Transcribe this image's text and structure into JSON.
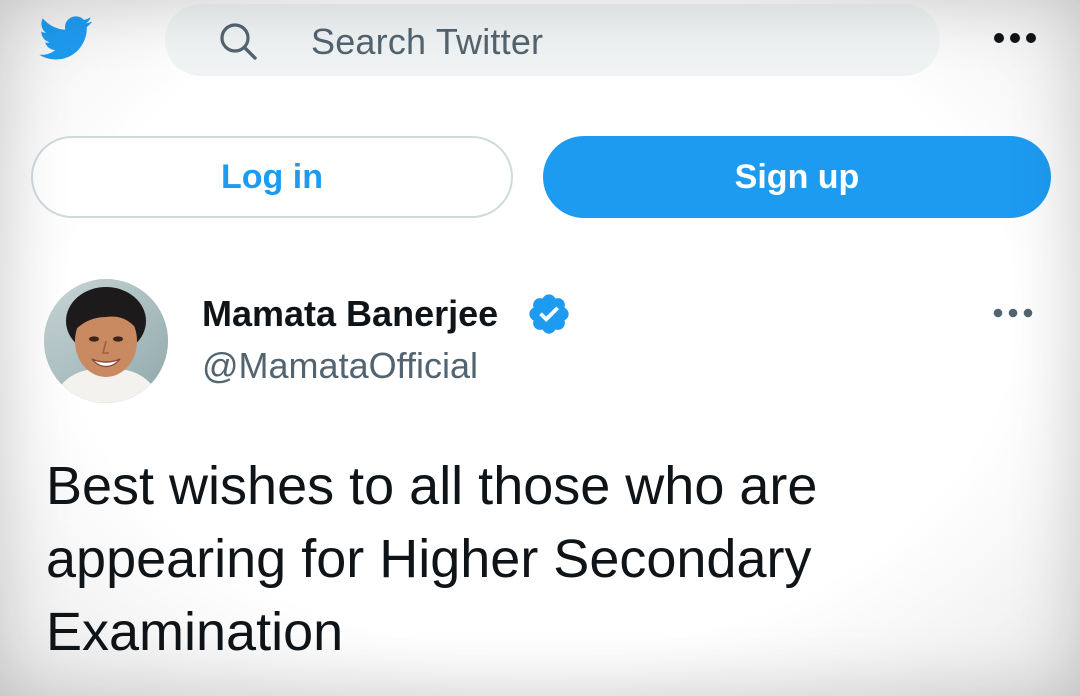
{
  "header": {
    "logo_icon": "twitter-bird-icon",
    "search": {
      "icon": "search-icon",
      "placeholder": "Search Twitter"
    },
    "more_icon": "more-horizontal-icon"
  },
  "auth": {
    "login_label": "Log in",
    "signup_label": "Sign up"
  },
  "tweet": {
    "author": {
      "name": "Mamata Banerjee",
      "handle": "@MamataOfficial",
      "verified": true,
      "avatar": "avatar-photo"
    },
    "more_icon": "more-horizontal-icon",
    "text": "Best wishes to all those who are appearing for Higher Secondary Examination"
  },
  "colors": {
    "accent": "#1d9bf0",
    "text_primary": "#0f1419",
    "text_secondary": "#536471",
    "search_bg": "#eff3f4",
    "border": "#cfd9de"
  }
}
